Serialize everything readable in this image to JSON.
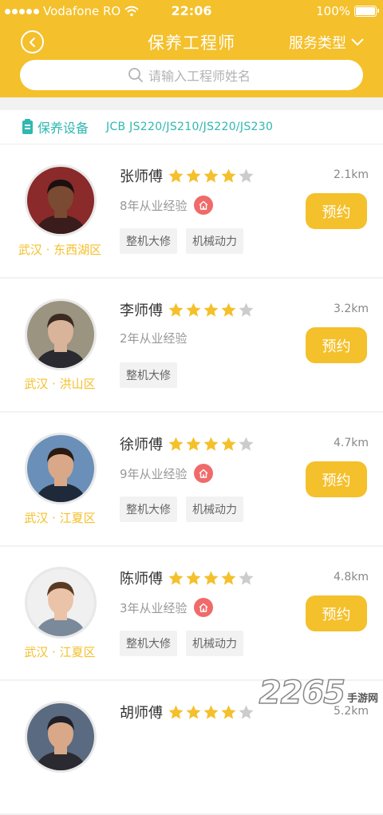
{
  "status_bar": {
    "carrier": "Vodafone RO",
    "time": "22:06",
    "battery": "100%"
  },
  "header": {
    "title": "保养工程师",
    "service_type_label": "服务类型"
  },
  "search": {
    "placeholder": "请输入工程师姓名"
  },
  "equipment": {
    "label": "保养设备",
    "value": "JCB JS220/JS210/JS220/JS230"
  },
  "engineers": [
    {
      "name": "张师傅",
      "rating": 4,
      "distance": "2.1km",
      "experience": "8年从业经验",
      "onsite": true,
      "tags": [
        "整机大修",
        "机械动力"
      ],
      "location": "武汉 · 东西湖区",
      "book_label": "预约",
      "avatar_colors": {
        "bg": "#8a2a2a",
        "skin": "#7a4a32",
        "hair": "#1a1010",
        "shirt": "#3a1c1c"
      }
    },
    {
      "name": "李师傅",
      "rating": 4,
      "distance": "3.2km",
      "experience": "2年从业经验",
      "onsite": false,
      "tags": [
        "整机大修"
      ],
      "location": "武汉 · 洪山区",
      "book_label": "预约",
      "avatar_colors": {
        "bg": "#9a9480",
        "skin": "#d9b39a",
        "hair": "#3a2a20",
        "shirt": "#2a2a30"
      }
    },
    {
      "name": "徐师傅",
      "rating": 4,
      "distance": "4.7km",
      "experience": "9年从业经验",
      "onsite": true,
      "tags": [
        "整机大修",
        "机械动力"
      ],
      "location": "武汉 · 江夏区",
      "book_label": "预约",
      "avatar_colors": {
        "bg": "#6a8fb8",
        "skin": "#d8a888",
        "hair": "#2a1a10",
        "shirt": "#1e2a3a"
      }
    },
    {
      "name": "陈师傅",
      "rating": 4,
      "distance": "4.8km",
      "experience": "3年从业经验",
      "onsite": true,
      "tags": [
        "整机大修",
        "机械动力"
      ],
      "location": "武汉 · 江夏区",
      "book_label": "预约",
      "avatar_colors": {
        "bg": "#f0f0f0",
        "skin": "#eac3a8",
        "hair": "#5a3a22",
        "shirt": "#7a8a9a"
      }
    },
    {
      "name": "胡师傅",
      "rating": 4,
      "distance": "5.2km",
      "experience": "",
      "onsite": false,
      "tags": [],
      "location": "",
      "book_label": "",
      "avatar_colors": {
        "bg": "#5a6a80",
        "skin": "#d8a888",
        "hair": "#202028",
        "shirt": "#2a2a30"
      }
    }
  ],
  "watermark": {
    "number": "2265",
    "suffix": "手游网"
  },
  "colors": {
    "accent": "#f4c02b",
    "teal": "#2fb8b0",
    "badge": "#f06a6a",
    "star_off": "#cccccc"
  },
  "icons": {
    "back": "back-arrow-icon",
    "dropdown": "chevron-down-icon",
    "search": "search-icon",
    "equipment": "device-icon",
    "home": "home-icon",
    "star": "star-icon"
  }
}
